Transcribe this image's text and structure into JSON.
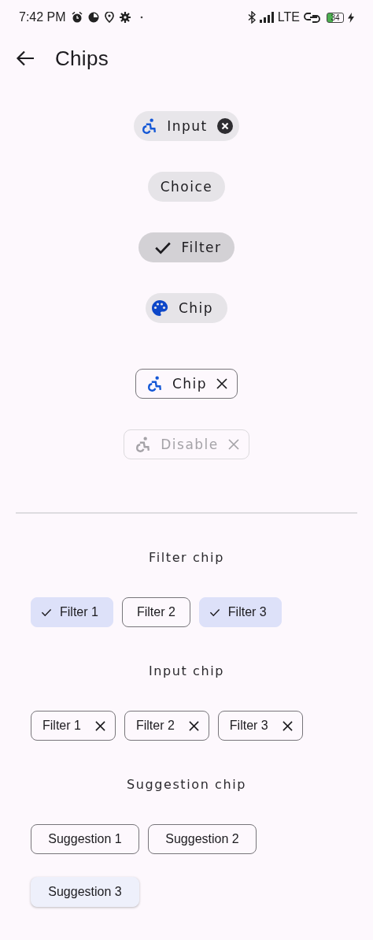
{
  "status_bar": {
    "time": "7:42 PM",
    "network": "LTE",
    "battery": "34"
  },
  "app_bar": {
    "title": "Chips"
  },
  "demo_chips": [
    {
      "kind": "input",
      "label": "Input"
    },
    {
      "kind": "choice",
      "label": "Choice"
    },
    {
      "kind": "filter",
      "label": "Filter",
      "selected": true
    },
    {
      "kind": "avatar",
      "label": "Chip"
    },
    {
      "kind": "outlined",
      "label": "Chip",
      "disabled": false
    },
    {
      "kind": "outlined",
      "label": "Disable",
      "disabled": true
    }
  ],
  "sections": [
    {
      "title": "Filter chip",
      "kind": "filter",
      "chips": [
        {
          "label": "Filter 1",
          "selected": true
        },
        {
          "label": "Filter 2",
          "selected": false
        },
        {
          "label": "Filter 3",
          "selected": true
        }
      ]
    },
    {
      "title": "Input chip",
      "kind": "input",
      "chips": [
        {
          "label": "Filter 1"
        },
        {
          "label": "Filter 2"
        },
        {
          "label": "Filter 3"
        }
      ]
    },
    {
      "title": "Suggestion chip",
      "kind": "suggestion",
      "chips": [
        {
          "label": "Suggestion 1",
          "elevated": false
        },
        {
          "label": "Suggestion 2",
          "elevated": false
        },
        {
          "label": "Suggestion 3",
          "elevated": true
        }
      ]
    }
  ]
}
